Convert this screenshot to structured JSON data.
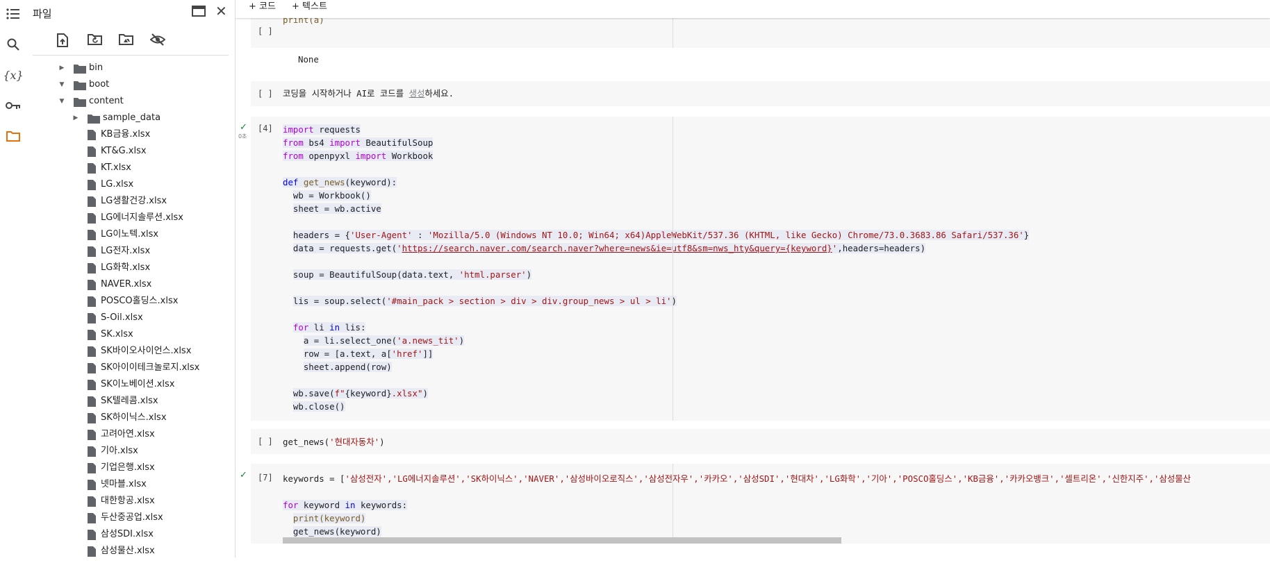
{
  "sidebar_panel": {
    "title": "파일",
    "tree": [
      {
        "name": "bin",
        "type": "folder",
        "depth": 0,
        "expanded": false
      },
      {
        "name": "boot",
        "type": "folder",
        "depth": 0,
        "expanded": true
      },
      {
        "name": "content",
        "type": "folder",
        "depth": 0,
        "expanded": true
      },
      {
        "name": "sample_data",
        "type": "folder",
        "depth": 1,
        "expanded": false
      },
      {
        "name": "KB금융.xlsx",
        "type": "file",
        "depth": 1
      },
      {
        "name": "KT&G.xlsx",
        "type": "file",
        "depth": 1
      },
      {
        "name": "KT.xlsx",
        "type": "file",
        "depth": 1
      },
      {
        "name": "LG.xlsx",
        "type": "file",
        "depth": 1
      },
      {
        "name": "LG생활건강.xlsx",
        "type": "file",
        "depth": 1
      },
      {
        "name": "LG에너지솔루션.xlsx",
        "type": "file",
        "depth": 1
      },
      {
        "name": "LG이노텍.xlsx",
        "type": "file",
        "depth": 1
      },
      {
        "name": "LG전자.xlsx",
        "type": "file",
        "depth": 1
      },
      {
        "name": "LG화학.xlsx",
        "type": "file",
        "depth": 1
      },
      {
        "name": "NAVER.xlsx",
        "type": "file",
        "depth": 1
      },
      {
        "name": "POSCO홀딩스.xlsx",
        "type": "file",
        "depth": 1
      },
      {
        "name": "S-Oil.xlsx",
        "type": "file",
        "depth": 1
      },
      {
        "name": "SK.xlsx",
        "type": "file",
        "depth": 1
      },
      {
        "name": "SK바이오사이언스.xlsx",
        "type": "file",
        "depth": 1
      },
      {
        "name": "SK아이이테크놀로지.xlsx",
        "type": "file",
        "depth": 1
      },
      {
        "name": "SK이노베이션.xlsx",
        "type": "file",
        "depth": 1
      },
      {
        "name": "SK텔레콤.xlsx",
        "type": "file",
        "depth": 1
      },
      {
        "name": "SK하이닉스.xlsx",
        "type": "file",
        "depth": 1
      },
      {
        "name": "고려아연.xlsx",
        "type": "file",
        "depth": 1
      },
      {
        "name": "기아.xlsx",
        "type": "file",
        "depth": 1
      },
      {
        "name": "기업은행.xlsx",
        "type": "file",
        "depth": 1
      },
      {
        "name": "넷마블.xlsx",
        "type": "file",
        "depth": 1
      },
      {
        "name": "대한항공.xlsx",
        "type": "file",
        "depth": 1
      },
      {
        "name": "두산중공업.xlsx",
        "type": "file",
        "depth": 1
      },
      {
        "name": "삼성SDI.xlsx",
        "type": "file",
        "depth": 1
      },
      {
        "name": "삼성물산.xlsx",
        "type": "file",
        "depth": 1
      }
    ]
  },
  "toolbar": {
    "add_code_label": "+ 코드",
    "add_text_label": "+ 텍스트"
  },
  "cells": {
    "c1": {
      "exec": "[ ]",
      "code_line": "print(a)",
      "output": "None"
    },
    "c2": {
      "exec": "[ ]",
      "placeholder_before": "코딩을 시작하거나 AI로 코드를 ",
      "placeholder_link": "생성",
      "placeholder_after": "하세요."
    },
    "c3": {
      "exec": "[4]",
      "status_time": "0초",
      "tokens": {
        "import": "import",
        "from": "from",
        "def": "def",
        "for": "for",
        "in": "in",
        "requests": "requests",
        "bs4": "bs4",
        "BeautifulSoup": "BeautifulSoup",
        "openpyxl": "openpyxl",
        "Workbook": "Workbook",
        "get_news": "get_news",
        "keyword_param": "(keyword):",
        "wb_assign": "wb = Workbook()",
        "sheet_assign": "sheet = wb.active",
        "headers_pre": "headers = {",
        "ua_key": "'User-Agent'",
        "ua_sep": " : ",
        "ua_val": "'Mozilla/5.0 (Windows NT 10.0; Win64; x64)AppleWebKit/537.36 (KHTML, like Gecko) Chrome/73.0.3683.86 Safari/537.36'",
        "headers_post": "}",
        "data_pre": "data = requests.get(",
        "url_quote": "'",
        "url": "https://search.naver.com/search.naver?where=news&ie=utf8&sm=nws_hty&query={keyword}",
        "data_post": ",headers=headers)",
        "soup_pre": "soup = BeautifulSoup(data.text, ",
        "soup_parser": "'html.parser'",
        "close_paren": ")",
        "lis_pre": "lis = soup.select(",
        "lis_selector": "'#main_pack > section > div > div.group_news > ul > li'",
        "for_li": "li",
        "for_lis": "lis:",
        "a_pre": "a = li.select_one(",
        "a_sel": "'a.news_tit'",
        "row_pre": "row = [a.text, a[",
        "row_key": "'href'",
        "row_post": "]]",
        "append_line": "sheet.append(row)",
        "save_pre": "wb.save(",
        "save_f": "f\"",
        "save_fmt": "{keyword}",
        "save_ext": ".xlsx\"",
        "close_line": "wb.close()"
      }
    },
    "c4": {
      "exec": "[ ]",
      "call_pre": "get_news(",
      "call_arg": "'현대자동차'",
      "call_post": ")"
    },
    "c5": {
      "exec": "[7]",
      "kw_pre": "keywords = [",
      "kw_list": "'삼성전자','LG에너지솔루션','SK하이닉스','NAVER','삼성바이오로직스','삼성전자우','카카오','삼성SDI','현대차','LG화학','기아','POSCO홀딩스','KB금융','카카오뱅크','셀트리온','신한지주','삼성물산",
      "for_kw": "keyword",
      "for_iter": "keywords:",
      "print_line": "print(keyword)",
      "call_line": "get_news(keyword)"
    }
  }
}
